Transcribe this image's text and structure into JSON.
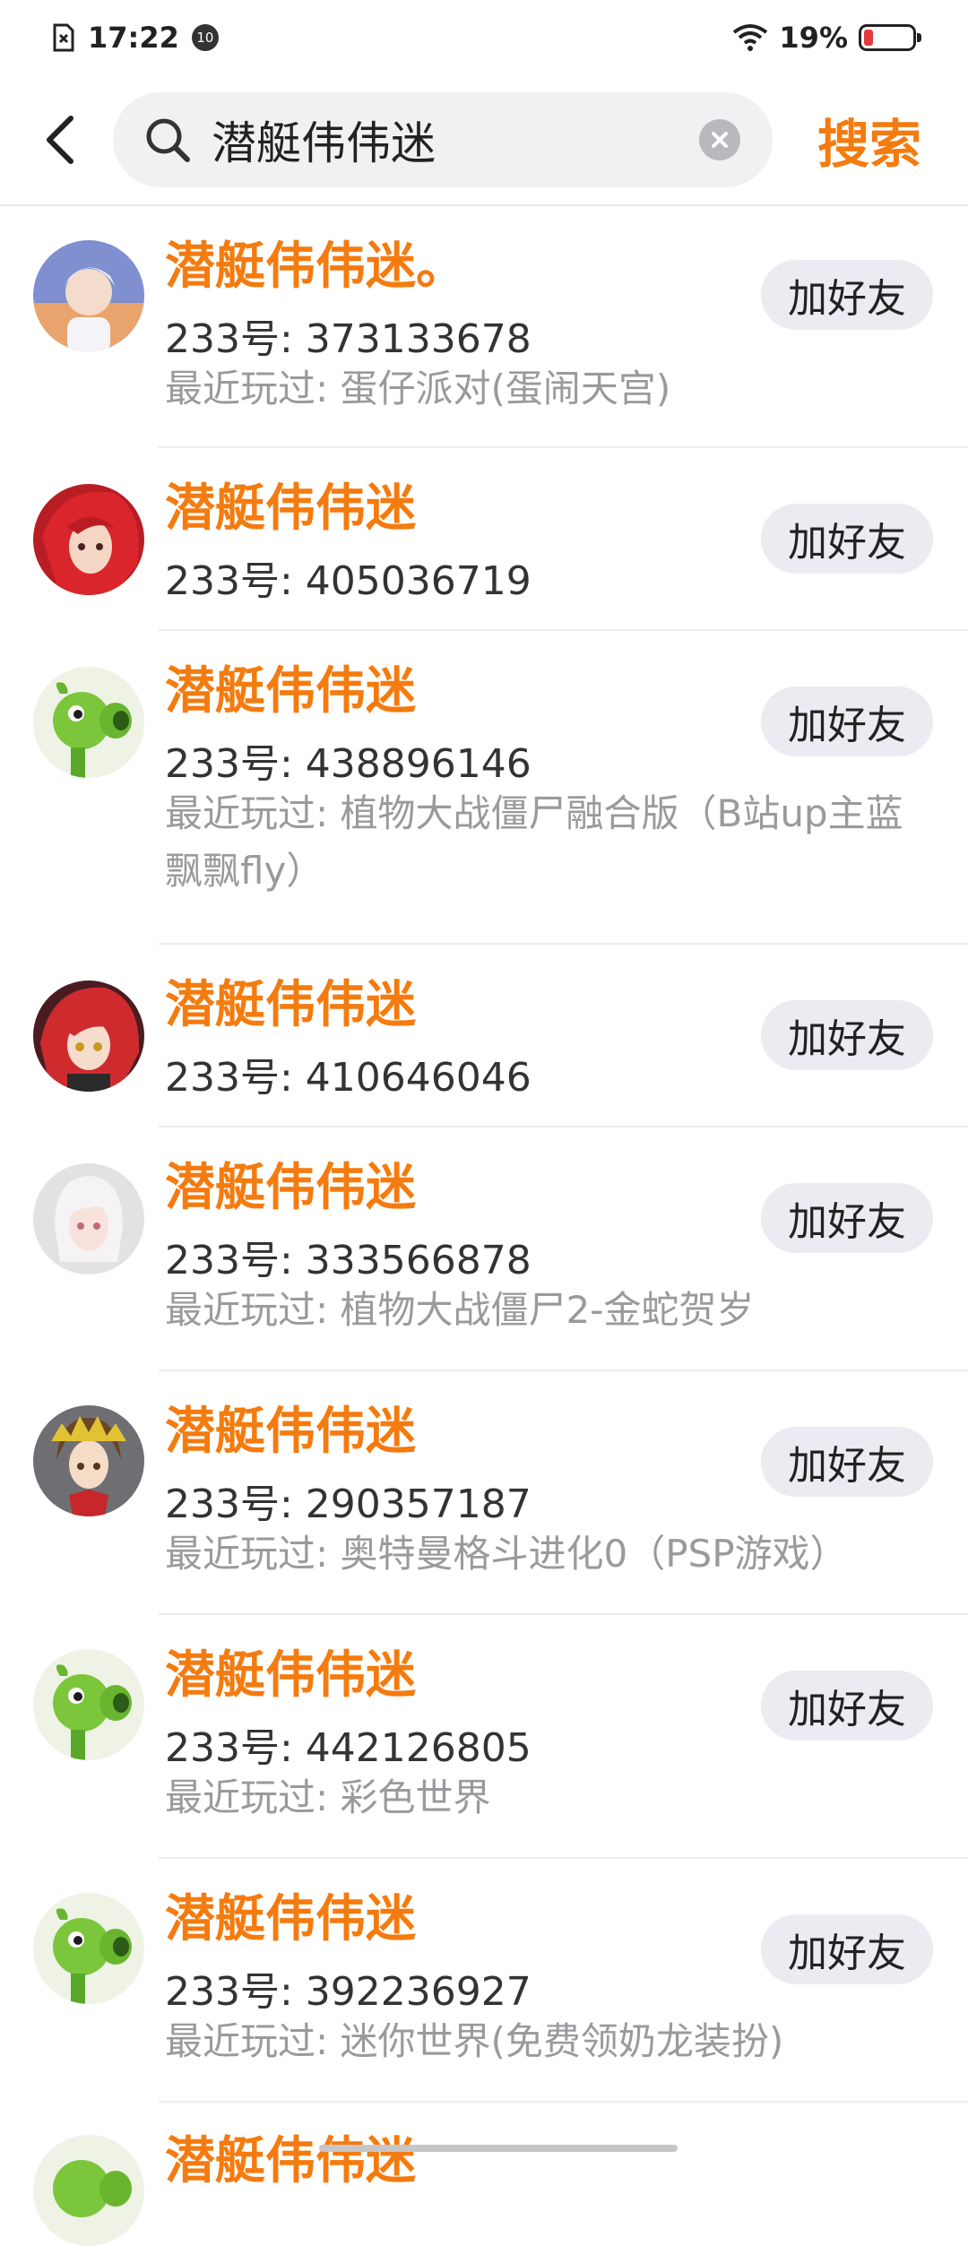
{
  "status_bar": {
    "time": "17:22",
    "notification_badge": "10",
    "battery": "19%",
    "battery_level": 0.19
  },
  "search": {
    "query": "潜艇伟伟迷",
    "submit_label": "搜索"
  },
  "results": [
    {
      "name": "潜艇伟伟迷。",
      "id": "233号: 373133678",
      "played": "最近玩过: 蛋仔派对(蛋闹天宫)",
      "add_label": "加好友",
      "avatar": "anime-boy"
    },
    {
      "name": "潜艇伟伟迷",
      "id": "233号: 405036719",
      "played": "",
      "add_label": "加好友",
      "avatar": "red-hair"
    },
    {
      "name": "潜艇伟伟迷",
      "id": "233号: 438896146",
      "played": "最近玩过: 植物大战僵尸融合版（B站up主蓝飘飘fly）",
      "add_label": "加好友",
      "avatar": "peashooter"
    },
    {
      "name": "潜艇伟伟迷",
      "id": "233号: 410646046",
      "played": "",
      "add_label": "加好友",
      "avatar": "red-hair-2"
    },
    {
      "name": "潜艇伟伟迷",
      "id": "233号: 333566878",
      "played": "最近玩过: 植物大战僵尸2-金蛇贺岁",
      "add_label": "加好友",
      "avatar": "white-hair"
    },
    {
      "name": "潜艇伟伟迷",
      "id": "233号: 290357187",
      "played": "最近玩过: 奥特曼格斗进化0（PSP游戏）",
      "add_label": "加好友",
      "avatar": "brown-hair"
    },
    {
      "name": "潜艇伟伟迷",
      "id": "233号: 442126805",
      "played": "最近玩过: 彩色世界",
      "add_label": "加好友",
      "avatar": "peashooter"
    },
    {
      "name": "潜艇伟伟迷",
      "id": "233号: 392236927",
      "played": "最近玩过: 迷你世界(免费领奶龙装扮)",
      "add_label": "加好友",
      "avatar": "peashooter"
    },
    {
      "name": "潜艇伟伟迷",
      "id": "",
      "played": "",
      "add_label": "",
      "avatar": "peashooter"
    }
  ]
}
